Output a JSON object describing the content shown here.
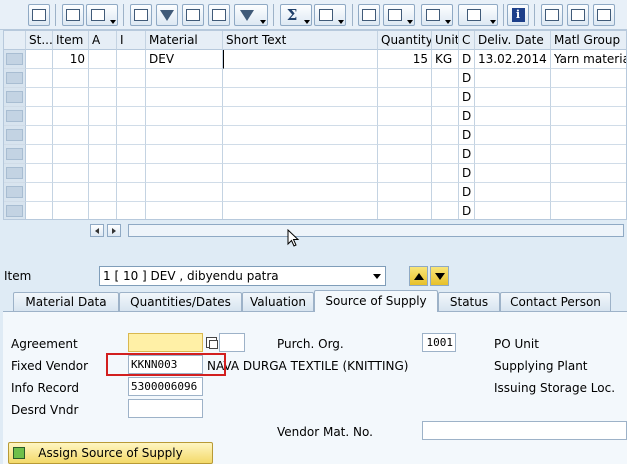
{
  "toolbar": {
    "icons": [
      "find-icon",
      "copy-icon",
      "delete-icon",
      "print-icon",
      "filter-icon",
      "find-next-icon",
      "set-filter-icon",
      "sum-icon",
      "subtotal-icon",
      "layout-icon",
      "views-icon",
      "export-icon",
      "grid-layout-icon",
      "info-icon",
      "details-icon",
      "settings-icon",
      "config-icon"
    ]
  },
  "table": {
    "headers": [
      "St...",
      "Item",
      "A",
      "I",
      "Material",
      "Short Text",
      "Quantity",
      "Unit",
      "C",
      "Deliv. Date",
      "Matl Group"
    ],
    "rows": [
      [
        "",
        "10",
        "",
        "",
        "DEV",
        "",
        "15",
        "KG",
        "D",
        "13.02.2014",
        "Yarn materia"
      ],
      [
        "",
        "",
        "",
        "",
        "",
        "",
        "",
        "",
        "D",
        "",
        ""
      ],
      [
        "",
        "",
        "",
        "",
        "",
        "",
        "",
        "",
        "D",
        "",
        ""
      ],
      [
        "",
        "",
        "",
        "",
        "",
        "",
        "",
        "",
        "D",
        "",
        ""
      ],
      [
        "",
        "",
        "",
        "",
        "",
        "",
        "",
        "",
        "D",
        "",
        ""
      ],
      [
        "",
        "",
        "",
        "",
        "",
        "",
        "",
        "",
        "D",
        "",
        ""
      ],
      [
        "",
        "",
        "",
        "",
        "",
        "",
        "",
        "",
        "D",
        "",
        ""
      ],
      [
        "",
        "",
        "",
        "",
        "",
        "",
        "",
        "",
        "D",
        "",
        ""
      ],
      [
        "",
        "",
        "",
        "",
        "",
        "",
        "",
        "",
        "D",
        "",
        ""
      ]
    ]
  },
  "item_selector": {
    "label": "Item",
    "value": "1 [ 10 ] DEV , dibyendu patra"
  },
  "tabs": [
    "Material Data",
    "Quantities/Dates",
    "Valuation",
    "Source of Supply",
    "Status",
    "Contact Person"
  ],
  "active_tab": "Source of Supply",
  "form": {
    "agreement_label": "Agreement",
    "agreement_value": "",
    "agreement_item_value": "",
    "fixed_vendor_label": "Fixed Vendor",
    "fixed_vendor_value": "KKNN003",
    "vendor_name": "NAVA DURGA TEXTILE (KNITTING)",
    "info_record_label": "Info Record",
    "info_record_value": "5300006096",
    "desired_vendor_label": "Desrd Vndr",
    "desired_vendor_value": "",
    "purch_org_label": "Purch. Org.",
    "purch_org_value": "1001",
    "po_unit_label": "PO Unit",
    "supplying_plant_label": "Supplying Plant",
    "issuing_storage_label": "Issuing Storage Loc.",
    "vendor_mat_no_label": "Vendor Mat. No.",
    "vendor_mat_no_value": ""
  },
  "assign_button": "Assign Source of Supply",
  "colors": {
    "highlight_box": "#d21f1f",
    "required_field": "#fff0a6"
  }
}
